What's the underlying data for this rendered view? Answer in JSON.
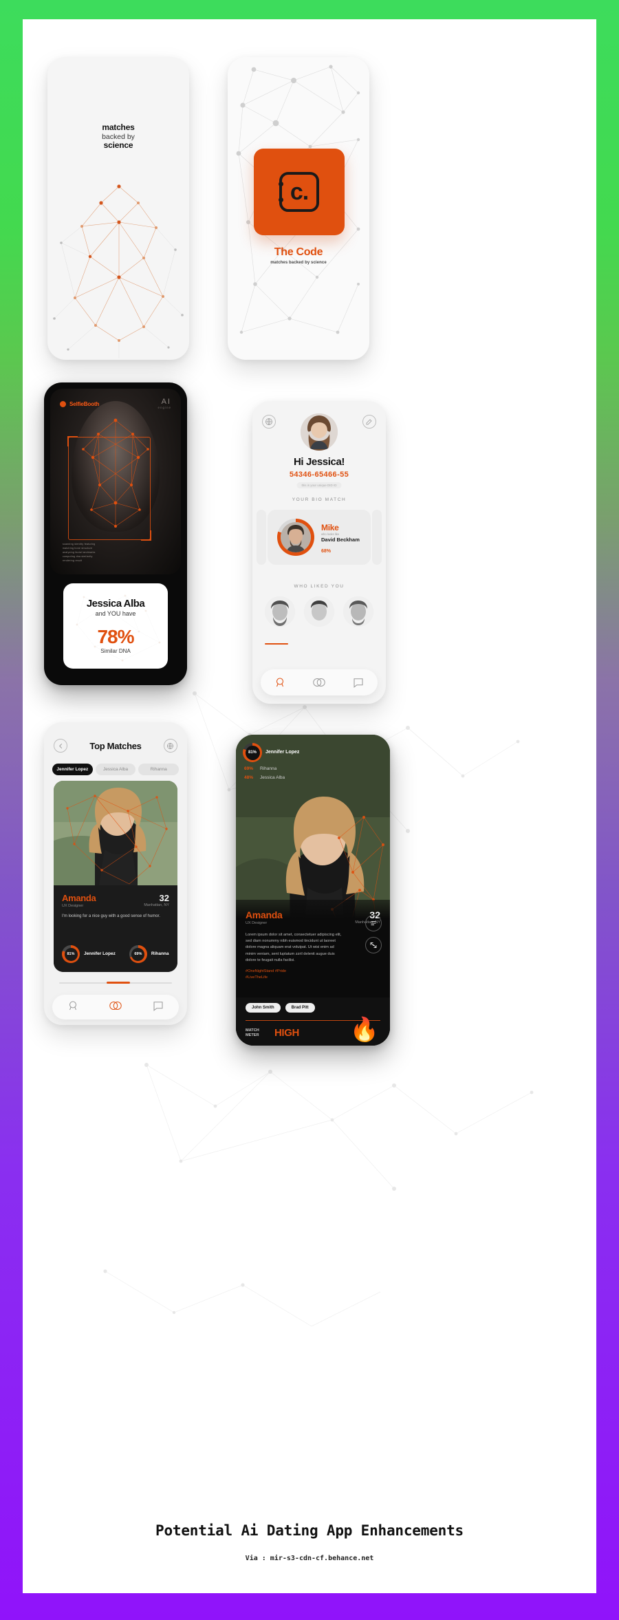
{
  "poster": {
    "title": "Potential Ai Dating App Enhancements",
    "source": "Via : mir-s3-cdn-cf.behance.net",
    "accent": "#e0500f",
    "bg_gradient_top": "#3ddc5c",
    "bg_gradient_bottom": "#9013fa"
  },
  "screen_splash": {
    "line1": "matches",
    "line2": "backed by",
    "line3": "science"
  },
  "screen_code": {
    "logo_letter": "c.",
    "title": "The Code",
    "subtitle": "matches backed by science"
  },
  "screen_selfiebooth": {
    "brand": "SelfieBooth",
    "ai_label": "AI",
    "ai_sub": "engine",
    "readout": [
      "scanning  identity  featuring",
      "matching  bone  structure",
      "analyzing  facial  landmarks",
      "computing  dna  similarity",
      "rendering  result"
    ],
    "result": {
      "name": "Jessica Alba",
      "subtitle": "and YOU have",
      "percent": "78%",
      "percent_label": "Similar DNA"
    }
  },
  "screen_profile": {
    "greeting": "Hi Jessica!",
    "dna_id": "54346-65466-55",
    "dna_id_note": "this is your unique DID ID",
    "bio_match_label": "YOUR BIO MATCH",
    "bio_match": {
      "name": "Mike",
      "looks_like_label": "who looks like",
      "celebrity": "David Beckham",
      "percent": "68%",
      "ring_pct": 80
    },
    "who_liked_label": "WHO LIKED YOU",
    "who_liked_count": 3,
    "tabs": [
      "profile-tab",
      "matches-tab",
      "chat-tab"
    ]
  },
  "screen_top_matches": {
    "title": "Top Matches",
    "back_icon": "chevron-left-icon",
    "filter_icon": "globe-icon",
    "chips": [
      {
        "label": "Jennifer Lopez",
        "active": true
      },
      {
        "label": "Jessica Alba",
        "active": false
      },
      {
        "label": "Rihanna",
        "active": false
      }
    ],
    "card": {
      "name": "Amanda",
      "role": "UX Designer",
      "age": "32",
      "location": "Manhattan, NY",
      "bio": "I'm looking for a nice guy with a good sense of humor.",
      "scores": [
        {
          "percent": "81%",
          "value": 81,
          "label": "Jennifer Lopez"
        },
        {
          "percent": "69%",
          "value": 69,
          "label": "Rihanna"
        }
      ]
    },
    "tabs": [
      "profile-tab",
      "matches-tab",
      "chat-tab"
    ]
  },
  "screen_detail": {
    "main_score": {
      "percent": "81%",
      "value": 81,
      "label": "Jennifer Lopez"
    },
    "mini_scores": [
      {
        "percent": "69%",
        "label": "Rihanna"
      },
      {
        "percent": "48%",
        "label": "Jessica Alba"
      }
    ],
    "name": "Amanda",
    "role": "UX Designer",
    "age": "32",
    "location": "Manhattan, NY",
    "paragraph": "Lorem ipsum dolor sit amet, consectetuer adipiscing elit, sed diam nonummy nibh euismod tincidunt ut laoreet dolore magna aliquam erat volutpat. Ut wisi enim ad minim veniam, sent luptatum zzril delenit augue duis dolore te feugait nulla facilisi.",
    "tags": "#OneNightStand #Pride\n#LiveTheLife",
    "chips": [
      "John Smith",
      "Brad Pitt"
    ],
    "match_meter_label": "MATCH\nMETER",
    "match_meter_value": "HIGH",
    "action_icons": [
      "list-icon",
      "share-icon"
    ]
  }
}
